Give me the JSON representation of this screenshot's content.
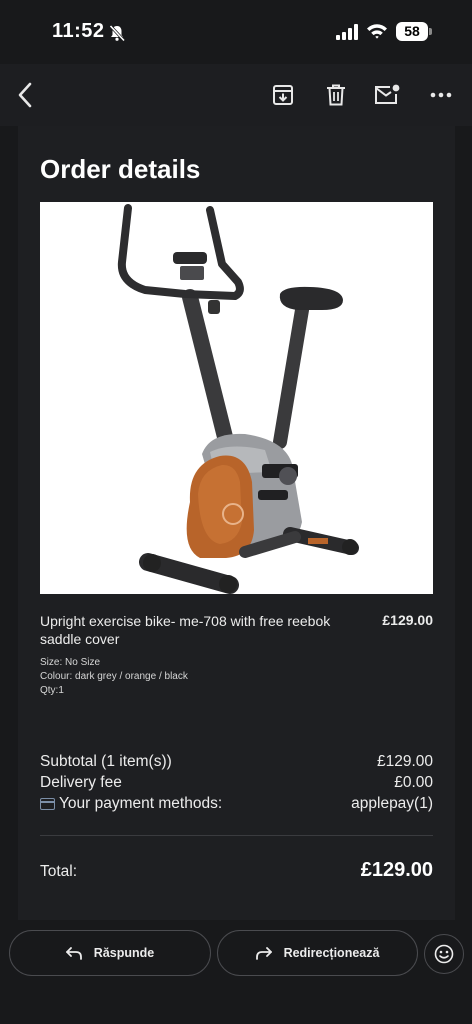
{
  "status_bar": {
    "time": "11:52",
    "battery": "58",
    "icons": [
      "bell-slash-icon",
      "cellular-signal-icon",
      "wifi-icon",
      "battery-icon"
    ]
  },
  "toolbar": {
    "icons": [
      "chevron-left-icon",
      "archive-icon",
      "trash-icon",
      "mark-unread-icon",
      "more-horizontal-icon"
    ]
  },
  "order": {
    "title": "Order details",
    "product": {
      "name": "Upright exercise bike- me-708 with free reebok saddle cover",
      "price": "£129.00",
      "size": "Size: No Size",
      "colour": "Colour: dark grey / orange / black",
      "qty": "Qty:1"
    },
    "summary": {
      "subtotal_label": "Subtotal (1 item(s))",
      "subtotal_value": "£129.00",
      "delivery_label": "Delivery fee",
      "delivery_value": "£0.00",
      "payment_label": "Your payment methods:",
      "payment_value": "applepay(1)",
      "total_label": "Total:",
      "total_value": "£129.00"
    }
  },
  "actions": {
    "reply_label": "Răspunde",
    "forward_label": "Redirecționează"
  },
  "colors": {
    "background": "#18191b",
    "card": "#1e1f22",
    "text": "#ececec",
    "bike_orange": "#b8642a"
  }
}
